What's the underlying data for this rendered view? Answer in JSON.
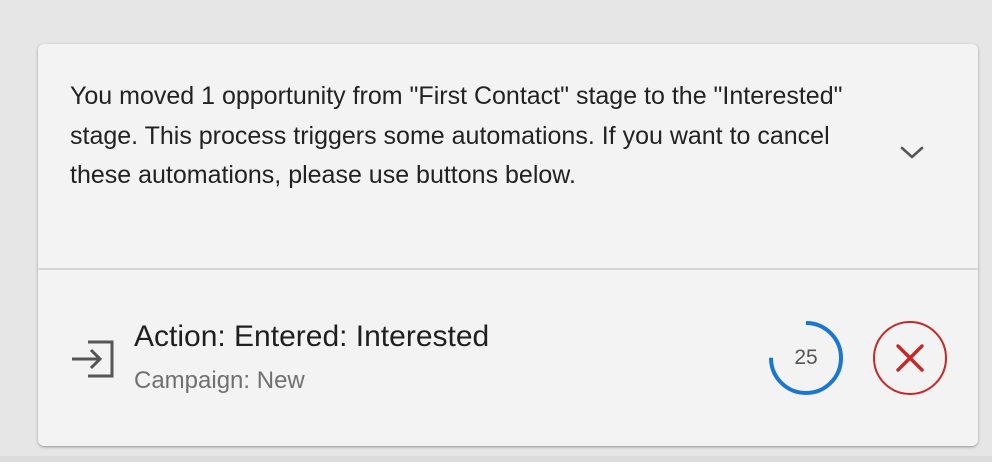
{
  "notice": {
    "message": "You moved 1 opportunity from \"First Contact\" stage to the \"Interested\" stage. This process triggers some automations. If you want to cancel these automations, please use buttons below."
  },
  "automation": {
    "icon": "login-enter-icon",
    "action_label": "Action: Entered: Interested",
    "campaign_label": "Campaign: New",
    "countdown": {
      "value": "25",
      "progress": 0.75
    },
    "cancel_icon": "close-icon"
  },
  "colors": {
    "countdown_ring": "#1976d2",
    "cancel_accent": "#c62828",
    "card_background": "#f3f3f3",
    "page_background": "#e6e6e6"
  }
}
